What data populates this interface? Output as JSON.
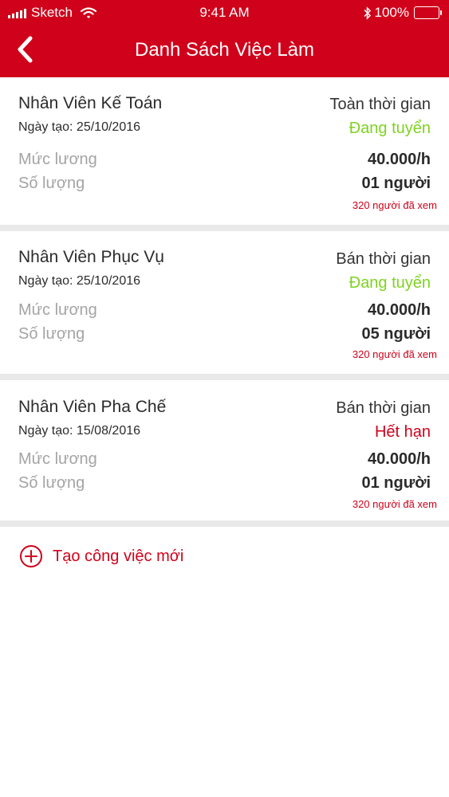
{
  "status_bar": {
    "carrier": "Sketch",
    "time": "9:41 AM",
    "battery": "100%"
  },
  "nav": {
    "title": "Danh Sách Việc Làm"
  },
  "labels": {
    "salary": "Mức lương",
    "quantity": "Số lượng"
  },
  "jobs": [
    {
      "title": "Nhân Viên Kế Toán",
      "created": "Ngày tạo: 25/10/2016",
      "type": "Toàn thời gian",
      "status": "Đang tuyển",
      "status_color": "#7ed321",
      "salary": "40.000/h",
      "quantity": "01 người",
      "views": "320 người đã xem"
    },
    {
      "title": "Nhân Viên Phục Vụ",
      "created": "Ngày tạo: 25/10/2016",
      "type": "Bán thời gian",
      "status": "Đang tuyển",
      "status_color": "#7ed321",
      "salary": "40.000/h",
      "quantity": "05 người",
      "views": "320 người đã xem"
    },
    {
      "title": "Nhân Viên Pha Chế",
      "created": "Ngày tạo: 15/08/2016",
      "type": "Bán thời gian",
      "status": "Hết hạn",
      "status_color": "#d0021b",
      "salary": "40.000/h",
      "quantity": "01 người",
      "views": "320 người đã xem"
    }
  ],
  "add_job": {
    "label": "Tạo công việc mới",
    "icon": "plus-circle-icon"
  },
  "colors": {
    "brand": "#d0021b",
    "active_status": "#7ed321",
    "expired_status": "#d0021b",
    "muted_label": "#a4a4a4",
    "separator": "#e9e9e9"
  }
}
